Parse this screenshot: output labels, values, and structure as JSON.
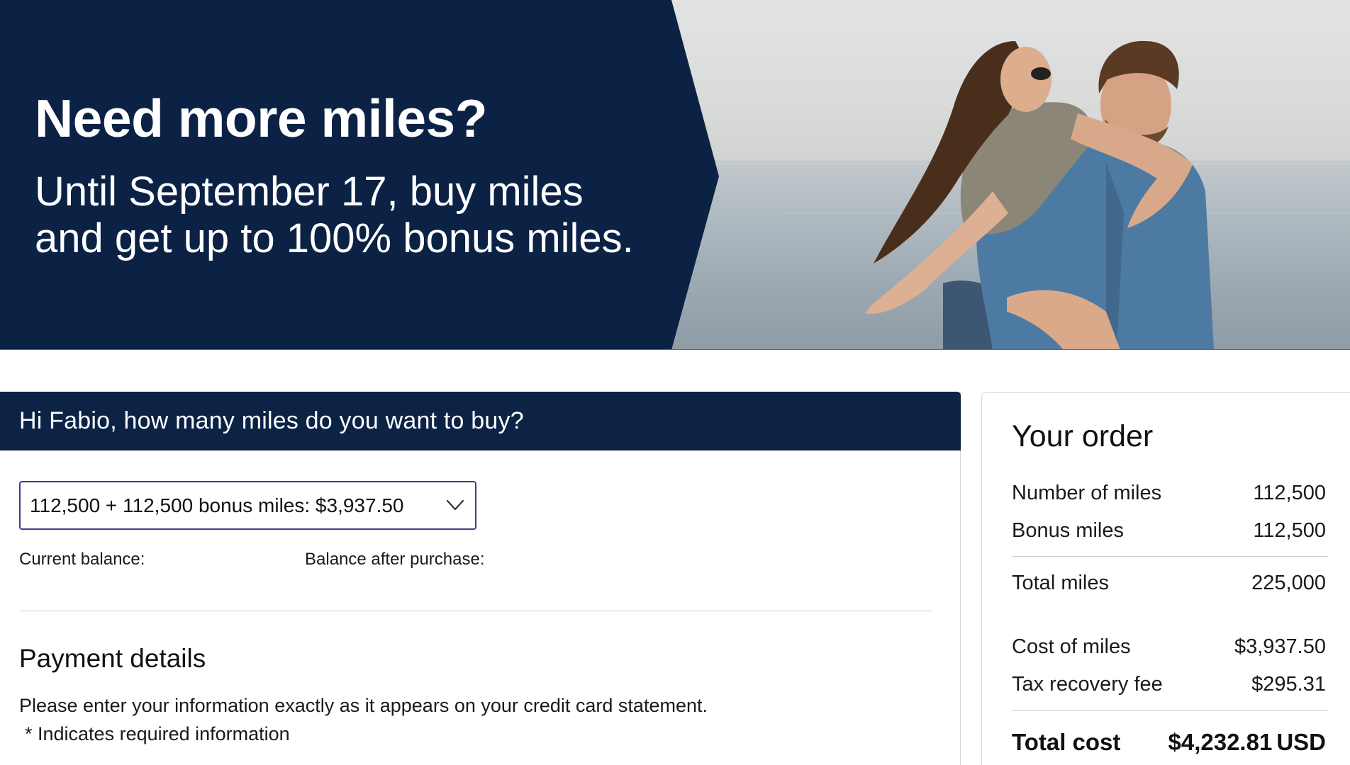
{
  "banner": {
    "headline": "Need more miles?",
    "subline_1": "Until September 17, buy miles",
    "subline_2": "and get up to 100% bonus miles."
  },
  "purchase": {
    "heading": "Hi Fabio, how many miles do you want to buy?",
    "selected_option": "112,500 + 112,500 bonus miles: $3,937.50",
    "current_balance_label": "Current balance:",
    "balance_after_label": "Balance after purchase:"
  },
  "payment": {
    "heading": "Payment details",
    "instructions": "Please enter your information exactly as it appears on your credit card statement.",
    "required_note": "* Indicates required information"
  },
  "order": {
    "title": "Your order",
    "rows": [
      {
        "label": "Number of miles",
        "value": "112,500"
      },
      {
        "label": "Bonus miles",
        "value": "112,500"
      },
      {
        "label": "Total miles",
        "value": "225,000"
      },
      {
        "label": "Cost of miles",
        "value": "$3,937.50"
      },
      {
        "label": "Tax recovery fee",
        "value": "$295.31"
      }
    ],
    "total_label": "Total cost",
    "total_value": "$4,232.81",
    "total_currency": "USD"
  },
  "icons": {
    "select_chevron": "chevron-down-icon"
  },
  "colors": {
    "navy": "#0c2345",
    "select_border": "#3e3c8e",
    "divider": "#c9ccd1",
    "text": "#1a1a1a"
  }
}
